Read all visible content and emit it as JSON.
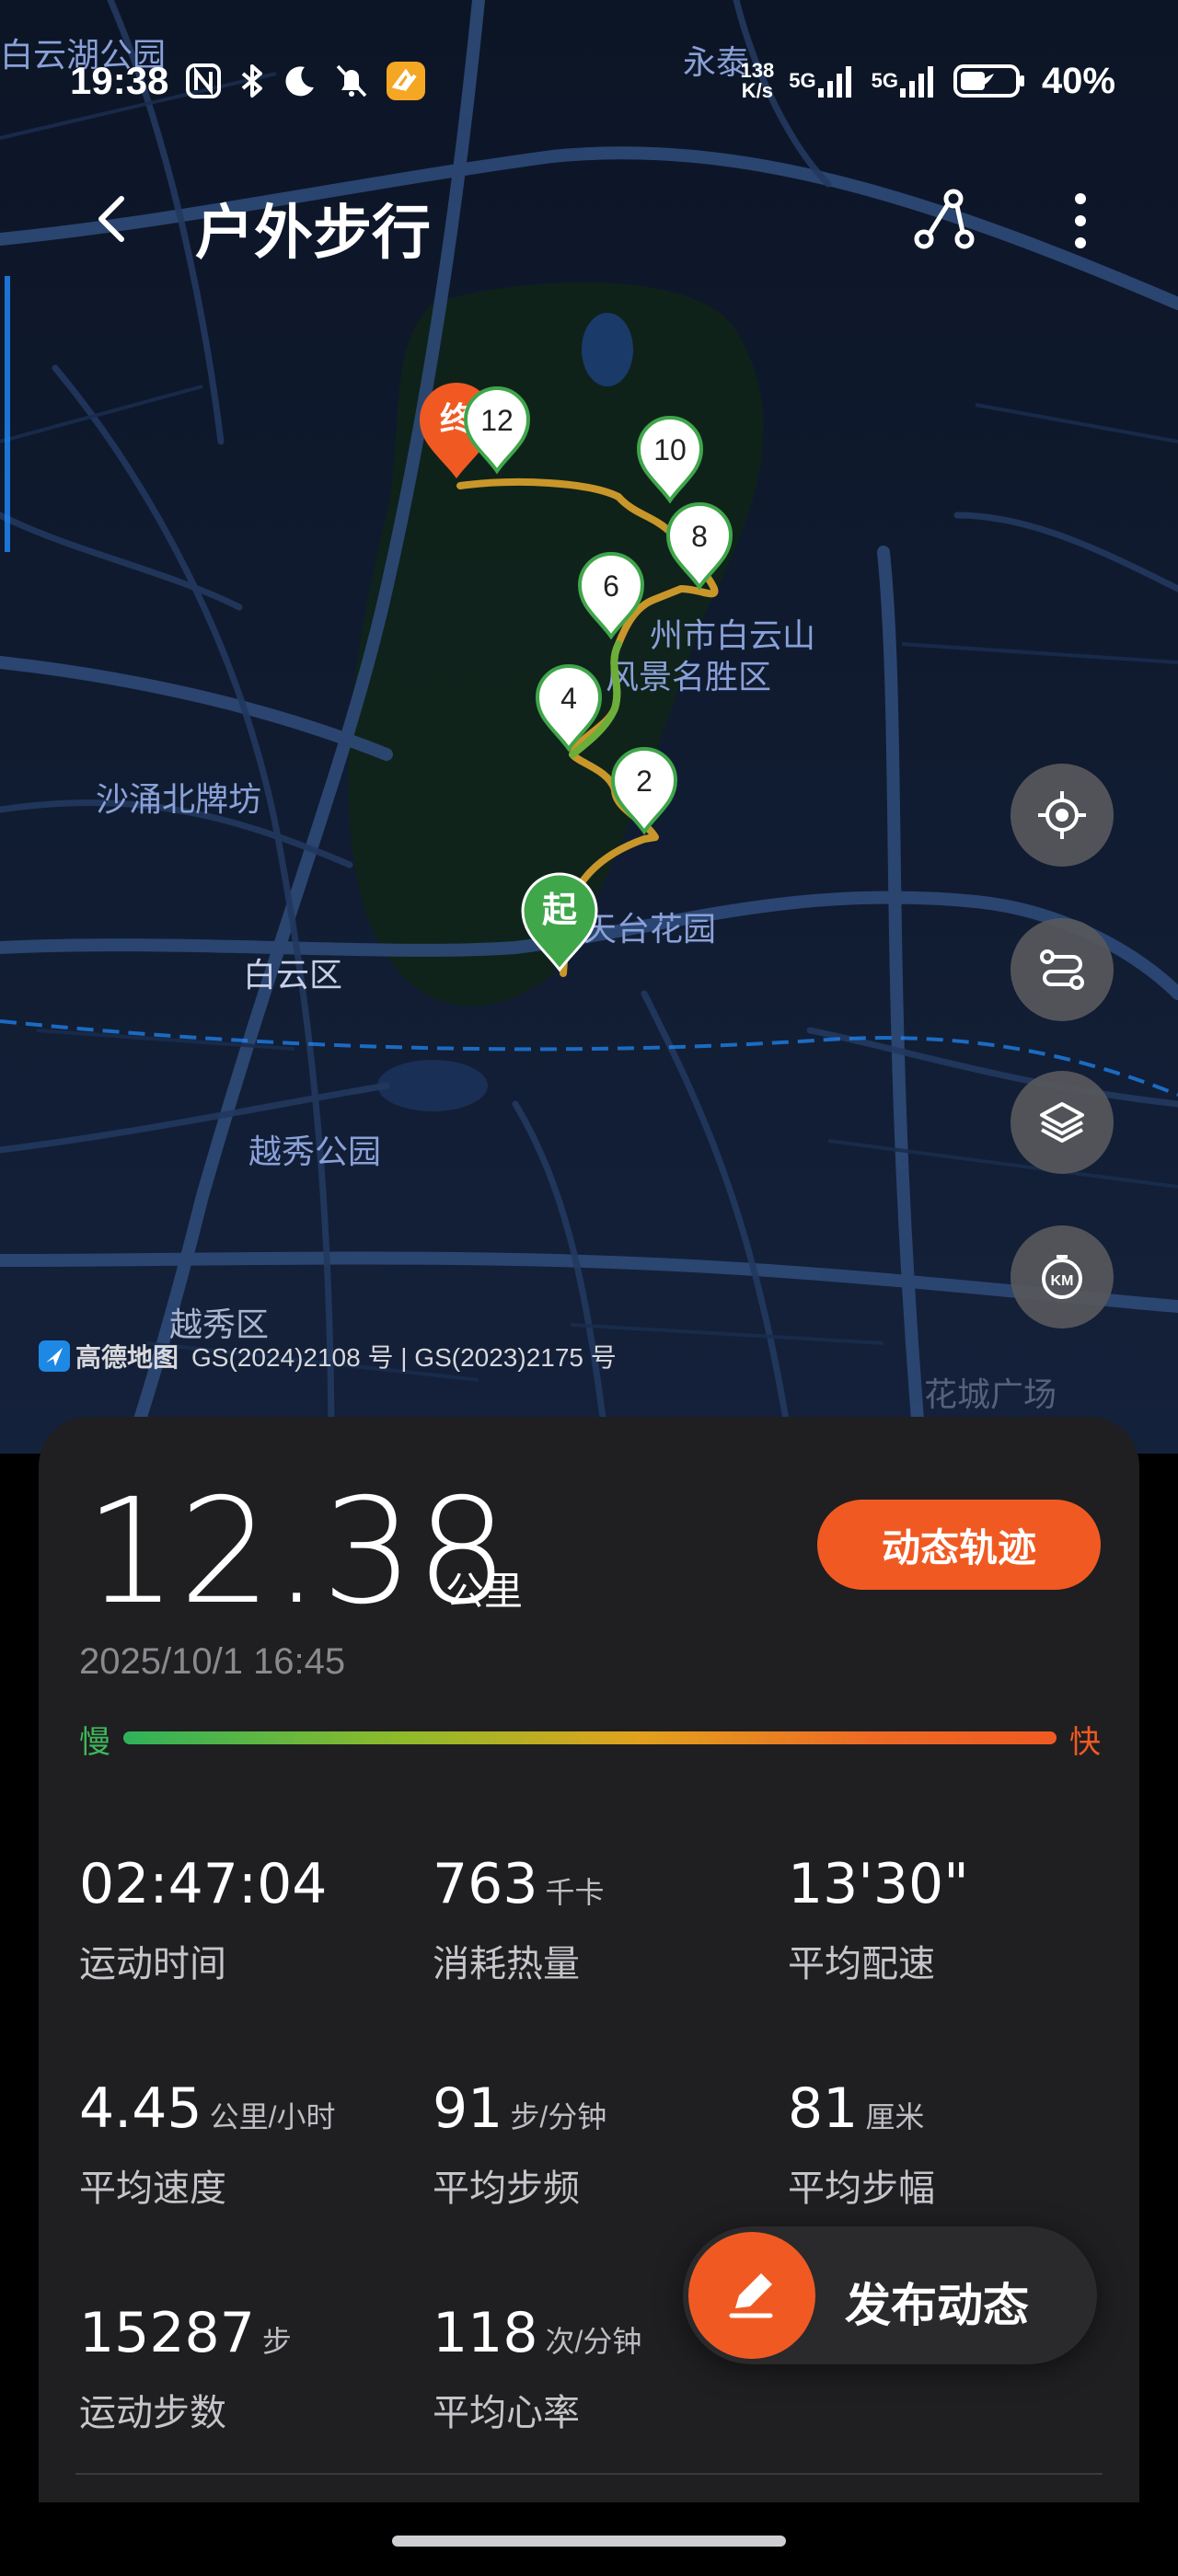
{
  "status_bar": {
    "time": "19:38",
    "net_speed_value": "138",
    "net_speed_unit": "K/s",
    "sim1": "5G",
    "sim2": "5G",
    "battery": "40%",
    "icons": [
      "nfc-icon",
      "bluetooth-icon",
      "moon-icon",
      "bell-off-icon",
      "app-notification-icon",
      "signal-icon",
      "battery-icon"
    ]
  },
  "header": {
    "title": "户外步行",
    "icons": [
      "back-icon",
      "route-share-icon",
      "more-icon"
    ]
  },
  "map": {
    "place_labels": [
      "白云湖公园",
      "永泰",
      "州市白云山",
      "风景名胜区",
      "沙涌北牌坊",
      "白云区",
      "越秀公园",
      "越秀区",
      "花城广场",
      "天台花园"
    ],
    "start_marker": "起",
    "end_marker": "终",
    "km_markers": [
      "2",
      "4",
      "6",
      "8",
      "10",
      "12"
    ],
    "credit_logo": "高德地图",
    "credit_text": "GS(2024)2108 号 | GS(2023)2175 号",
    "fab_icons": [
      "locate-icon",
      "route-toggle-icon",
      "layers-icon",
      "km-marker-icon"
    ]
  },
  "summary": {
    "distance": "12.38",
    "distance_unit": "公里",
    "dynamic_track_button": "动态轨迹",
    "date": "2025/10/1 16:45",
    "speed_slow": "慢",
    "speed_fast": "快"
  },
  "stats": [
    {
      "value": "02:47:04",
      "unit": "",
      "label": "运动时间"
    },
    {
      "value": "763",
      "unit": "千卡",
      "label": "消耗热量"
    },
    {
      "value": "13'30\"",
      "unit": "",
      "label": "平均配速"
    },
    {
      "value": "4.45",
      "unit": "公里/小时",
      "label": "平均速度"
    },
    {
      "value": "91",
      "unit": "步/分钟",
      "label": "平均步频"
    },
    {
      "value": "81",
      "unit": "厘米",
      "label": "平均步幅"
    },
    {
      "value": "15287",
      "unit": "步",
      "label": "运动步数"
    },
    {
      "value": "118",
      "unit": "次/分钟",
      "label": "平均心率"
    }
  ],
  "publish_button": "发布动态",
  "colors": {
    "accent": "#f05a22",
    "panel_bg": "#1f1f21",
    "map_bg": "#0f1a2e",
    "start_green": "#3fa64a",
    "track_gold": "#c9962a"
  }
}
